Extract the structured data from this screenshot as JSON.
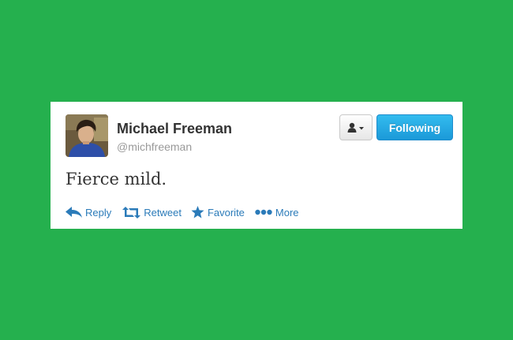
{
  "user": {
    "display_name": "Michael Freeman",
    "screen_name": "@michfreeman",
    "avatar_icon": "user-avatar-photo"
  },
  "buttons": {
    "user_menu_icon": "person-dropdown-icon",
    "following_label": "Following"
  },
  "tweet": {
    "text": "Fierce mild."
  },
  "actions": {
    "reply_label": "Reply",
    "retweet_label": "Retweet",
    "favorite_label": "Favorite",
    "more_label": "More"
  },
  "colors": {
    "background": "#25b04e",
    "card": "#ffffff",
    "link_blue": "#2b7bb9",
    "following_button": "#1b99d8",
    "name_text": "#333333",
    "handle_text": "#999999"
  }
}
